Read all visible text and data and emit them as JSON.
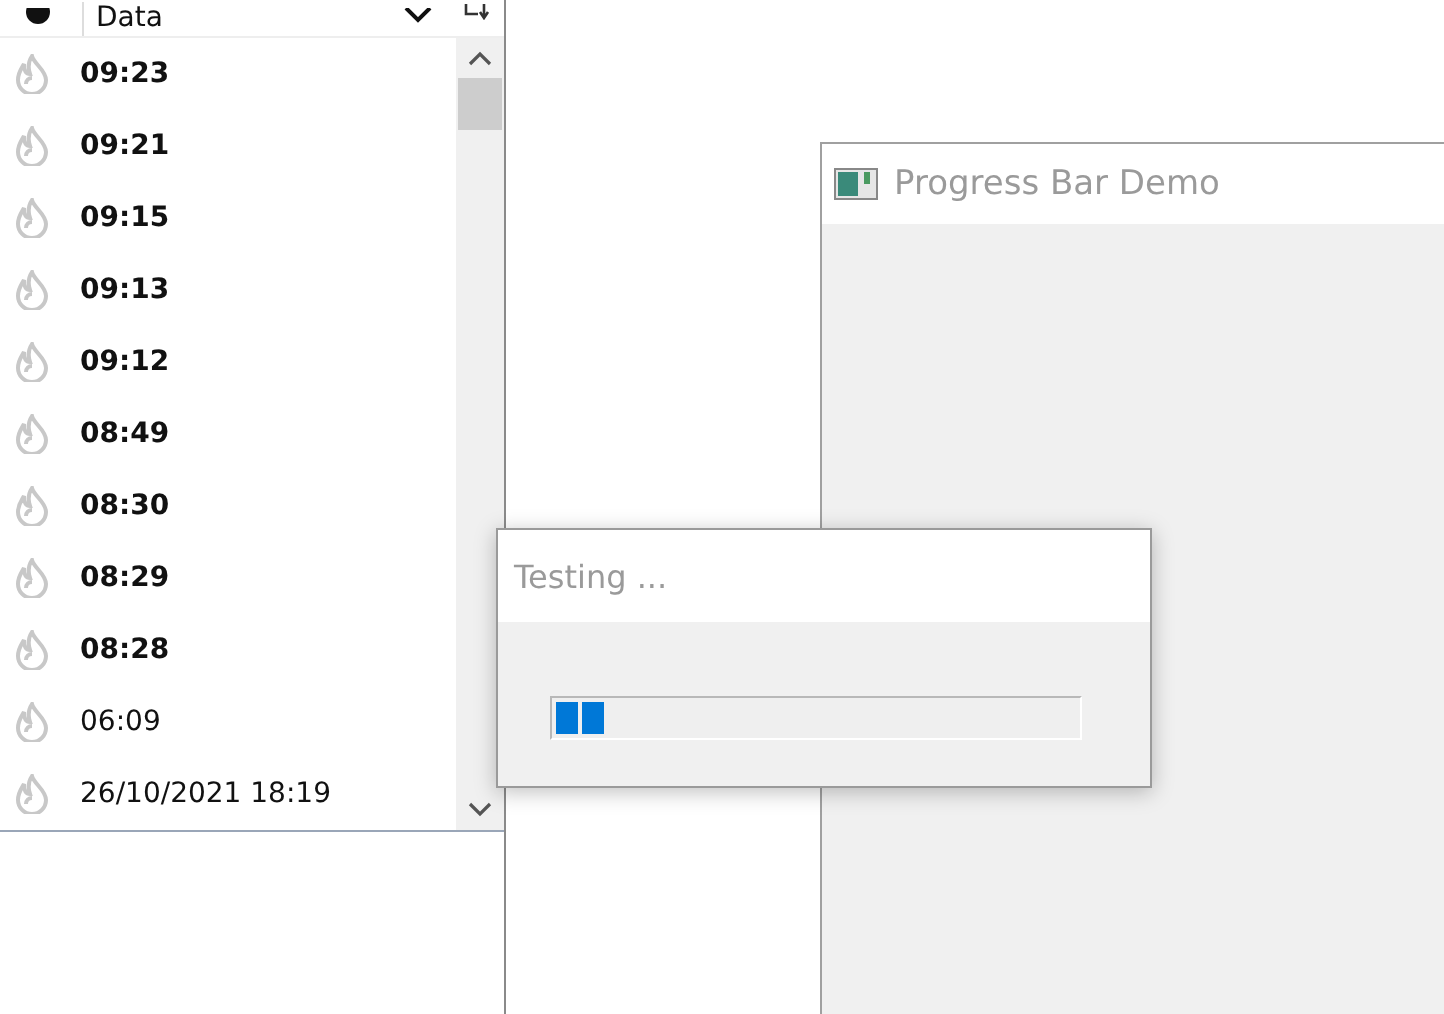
{
  "list": {
    "header": "Data",
    "rows": [
      {
        "text": "09:23",
        "unread": true
      },
      {
        "text": "09:21",
        "unread": true
      },
      {
        "text": "09:15",
        "unread": true
      },
      {
        "text": "09:13",
        "unread": true
      },
      {
        "text": "09:12",
        "unread": true
      },
      {
        "text": "08:49",
        "unread": true
      },
      {
        "text": "08:30",
        "unread": true
      },
      {
        "text": "08:29",
        "unread": true
      },
      {
        "text": "08:28",
        "unread": true
      },
      {
        "text": "06:09",
        "unread": false
      },
      {
        "text": "26/10/2021 18:19",
        "unread": false
      }
    ]
  },
  "main_window": {
    "title": "Progress Bar Demo"
  },
  "dialog": {
    "title": "Testing ...",
    "progress": {
      "level": 0.1
    }
  }
}
